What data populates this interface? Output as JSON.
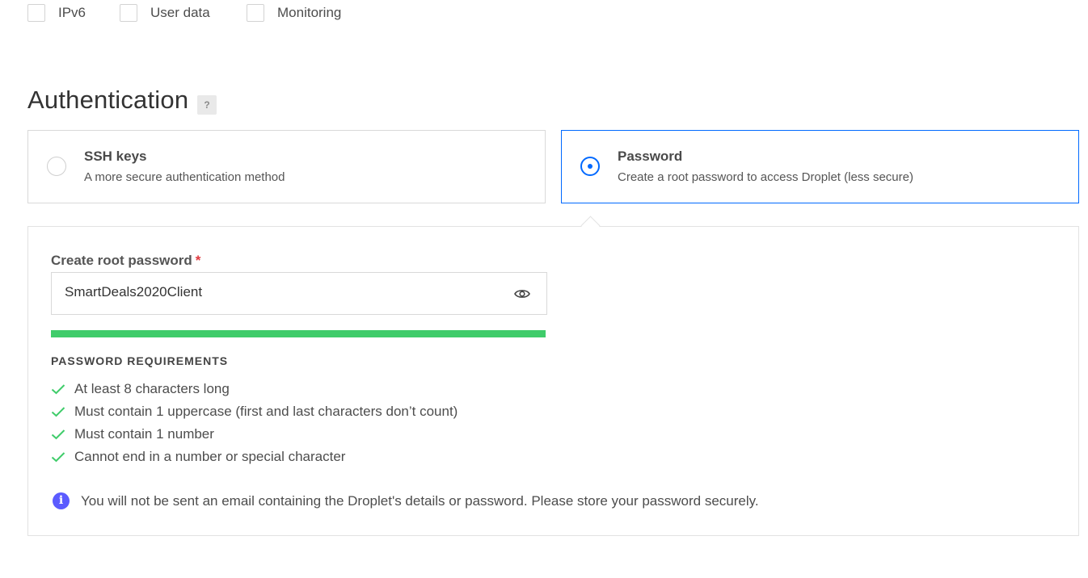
{
  "options": [
    {
      "label": "IPv6",
      "checked": false
    },
    {
      "label": "User data",
      "checked": false
    },
    {
      "label": "Monitoring",
      "checked": false
    }
  ],
  "authentication": {
    "title": "Authentication",
    "help_glyph": "?",
    "methods": [
      {
        "title": "SSH keys",
        "description": "A more secure authentication method",
        "selected": false
      },
      {
        "title": "Password",
        "description": "Create a root password to access Droplet (less secure)",
        "selected": true
      }
    ]
  },
  "password": {
    "label": "Create root password",
    "required_mark": "*",
    "value": "SmartDeals2020Client",
    "strength_fraction": 1.0,
    "strength_color": "#3fcc6a",
    "requirements_heading": "PASSWORD REQUIREMENTS",
    "requirements": [
      {
        "text": "At least 8 characters long",
        "met": true
      },
      {
        "text": "Must contain 1 uppercase (first and last characters don’t count)",
        "met": true
      },
      {
        "text": "Must contain 1 number",
        "met": true
      },
      {
        "text": "Cannot end in a number or special character",
        "met": true
      }
    ],
    "notice": "You will not be sent an email containing the Droplet's details or password. Please store your password securely."
  },
  "colors": {
    "accent": "#0069ff",
    "success": "#3fcc6a",
    "info": "#5b5bff",
    "required": "#e0393e"
  },
  "icons": {
    "eye": "eye-icon",
    "check": "checkmark-icon",
    "info": "info-icon",
    "help": "help-icon"
  }
}
